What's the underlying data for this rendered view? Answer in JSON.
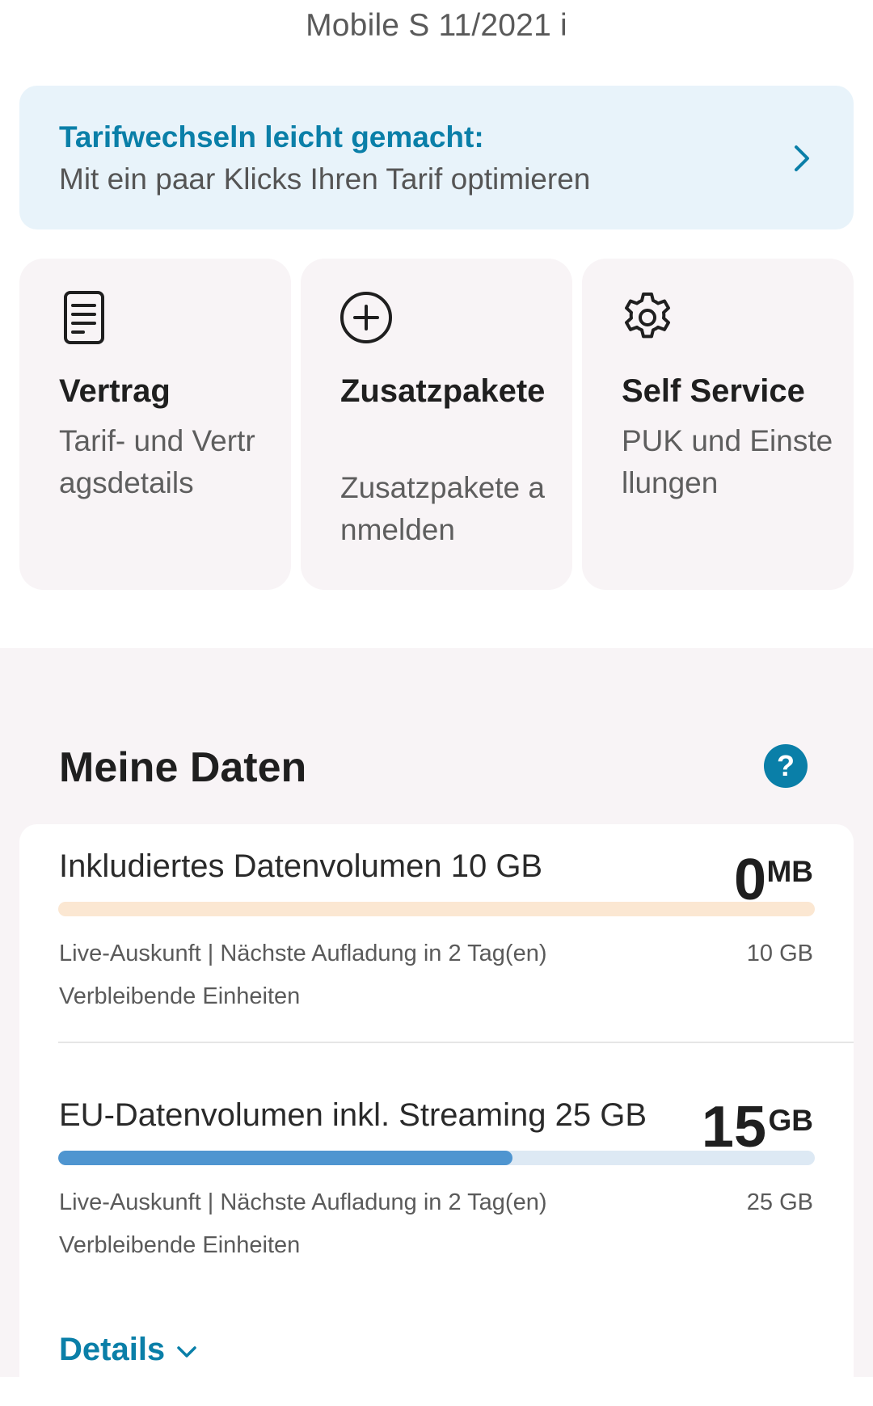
{
  "header": {
    "plan_title": "Mobile S 11/2021 i"
  },
  "promo": {
    "title": "Tarifwechseln leicht gemacht:",
    "subtitle": "Mit ein paar Klicks Ihren Tarif optimieren",
    "icon": "chevron-right-icon"
  },
  "tiles": [
    {
      "icon": "document-icon",
      "title": "Vertrag",
      "subtitle": "Tarif- und Vertragsdetails"
    },
    {
      "icon": "add-circle-icon",
      "title": "Zusatzpakete",
      "subtitle": "Zusatzpakete anmelden"
    },
    {
      "icon": "gear-icon",
      "title": "Self Service",
      "subtitle": "PUK und Einstellungen"
    }
  ],
  "data_section": {
    "title": "Meine Daten",
    "help_icon": "help-icon",
    "usages": [
      {
        "name": "Inkludiertes Datenvolumen 10 GB",
        "value": "0",
        "unit": "MB",
        "fill_fraction": 0.0,
        "live_info": "Live-Auskunft | Nächste Aufladung in 2 Tag(en)",
        "total": "10 GB",
        "remaining_label": "Verbleibende Einheiten"
      },
      {
        "name": "EU-Datenvolumen inkl. Streaming 25 GB",
        "value": "15",
        "unit": "GB",
        "fill_fraction": 0.6,
        "live_info": "Live-Auskunft | Nächste Aufladung in 2 Tag(en)",
        "total": "25 GB",
        "remaining_label": "Verbleibende Einheiten"
      }
    ],
    "details_label": "Details"
  },
  "colors": {
    "accent": "#0a7fa8",
    "bar_fill_eu": "#4f95d0",
    "bar_track_included": "#fbe7d2",
    "bar_track_eu": "#dde9f4",
    "promo_background": "#e8f3fa",
    "tile_background": "#f8f4f6"
  }
}
